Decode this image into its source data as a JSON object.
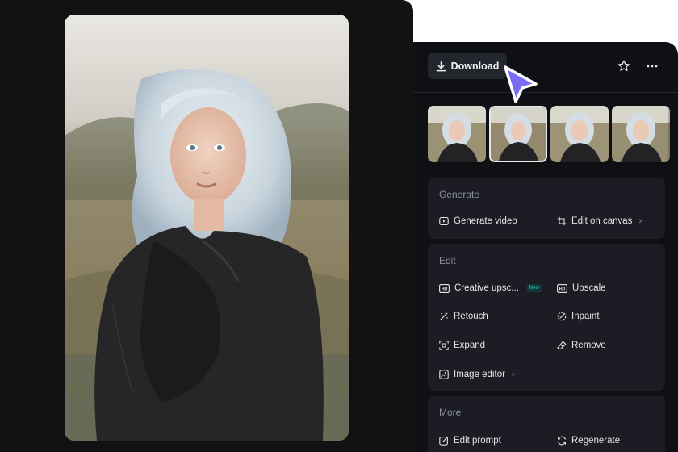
{
  "toolbar": {
    "download_label": "Download",
    "star_icon": "star-icon",
    "more_icon": "more-icon"
  },
  "thumbnails": {
    "count": 4,
    "selected_index": 1
  },
  "generate": {
    "title": "Generate",
    "items": [
      {
        "label": "Generate video",
        "icon": "video-icon"
      },
      {
        "label": "Edit on canvas",
        "icon": "crop-icon",
        "chevron": "›"
      }
    ]
  },
  "edit": {
    "title": "Edit",
    "items": [
      {
        "label": "Creative upsc...",
        "icon": "hd-icon",
        "badge": "New"
      },
      {
        "label": "Upscale",
        "icon": "hd-icon"
      },
      {
        "label": "Retouch",
        "icon": "magic-wand-icon"
      },
      {
        "label": "Inpaint",
        "icon": "inpaint-icon"
      },
      {
        "label": "Expand",
        "icon": "expand-icon"
      },
      {
        "label": "Remove",
        "icon": "eraser-icon"
      },
      {
        "label": "Image editor",
        "icon": "image-edit-icon",
        "chevron": "›"
      }
    ]
  },
  "more": {
    "title": "More",
    "items": [
      {
        "label": "Edit prompt",
        "icon": "edit-prompt-icon"
      },
      {
        "label": "Regenerate",
        "icon": "regenerate-icon"
      }
    ]
  },
  "colors": {
    "panel_bg": "#0f1013",
    "card_bg": "#1c1d24",
    "cursor_accent": "#7b6cf6",
    "badge_text": "#3fd0c0"
  }
}
